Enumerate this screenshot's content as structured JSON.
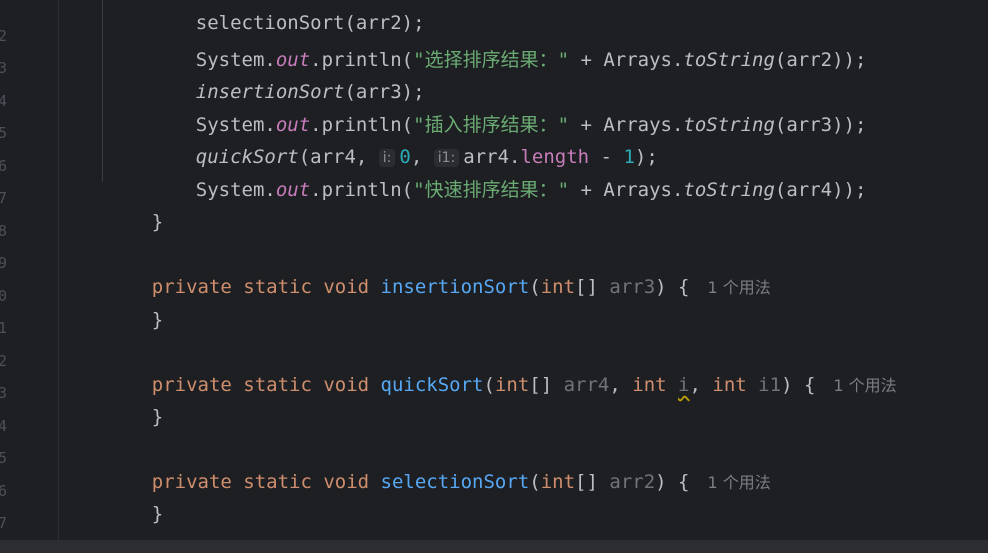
{
  "line_numbers": [
    "2",
    "3",
    "4",
    "5",
    "6",
    "7",
    "8",
    "9",
    "0",
    "1",
    "2",
    "3",
    "4",
    "5",
    "6",
    "7"
  ],
  "code": {
    "top_partial": "selectionSort(arr2);",
    "l1": {
      "a": "System.",
      "b": "out",
      "c": ".println(",
      "d": "\"选择排序结果：\"",
      "e": " + Arrays.",
      "f": "toString",
      "g": "(arr2));"
    },
    "l2": {
      "a": "insertionSort",
      "b": "(arr3);"
    },
    "l3": {
      "a": "System.",
      "b": "out",
      "c": ".println(",
      "d": "\"插入排序结果：\"",
      "e": " + Arrays.",
      "f": "toString",
      "g": "(arr3));"
    },
    "l4": {
      "a": "quickSort",
      "b": "(arr4, ",
      "h1": "i:",
      "c": "0",
      "d": ", ",
      "h2": "i1:",
      "e": "arr4.",
      "f": "length",
      "g": " - ",
      "n": "1",
      "z": ");"
    },
    "l5": {
      "a": "System.",
      "b": "out",
      "c": ".println(",
      "d": "\"快速排序结果：\"",
      "e": " + Arrays.",
      "f": "toString",
      "g": "(arr4));"
    },
    "l6": "}",
    "m1": {
      "kw": "private static void ",
      "name": "insertionSort",
      "p1": "(",
      "t": "int",
      "p2": "[] ",
      "arg": "arr3",
      "p3": ") {",
      "usage": "1 个用法"
    },
    "m1_close": "}",
    "m2": {
      "kw": "private static void ",
      "name": "quickSort",
      "p1": "(",
      "t": "int",
      "p2": "[] ",
      "arg": "arr4",
      "p3": ", ",
      "t2": "int",
      "sp": " ",
      "arg2": "i",
      "p4": ", ",
      "t3": "int",
      "sp2": " ",
      "arg3": "i1",
      "p5": ") {",
      "usage": "1 个用法"
    },
    "m2_close": "}",
    "m3": {
      "kw": "private static void ",
      "name": "selectionSort",
      "p1": "(",
      "t": "int",
      "p2": "[] ",
      "arg": "arr2",
      "p3": ") {",
      "usage": "1 个用法"
    },
    "m3_close": "}"
  }
}
